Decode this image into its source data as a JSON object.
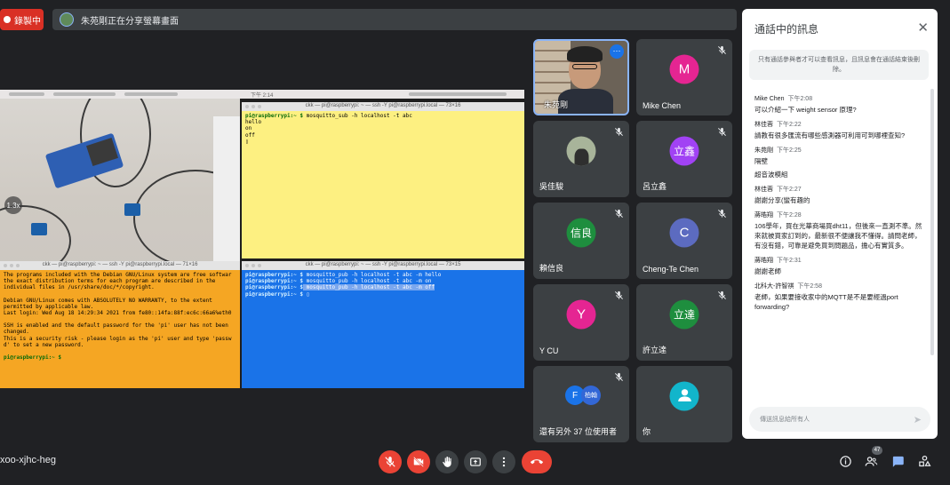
{
  "top": {
    "recording_label": "錄製中",
    "presenting_text": "朱苑剛正在分享螢幕畫面"
  },
  "screen": {
    "menubar_time": "下午 2:14",
    "photo_zoom": "1.3x",
    "term_yellow_title": "ckk — pi@raspberrypi: ~ — ssh -Y pi@raspberrypi.local — 73×16",
    "term_yellow_lines": [
      {
        "prompt": "pi@raspberrypi:~ $",
        "cmd": " mosquitto_sub -h localhost -t abc"
      },
      {
        "prompt": "",
        "cmd": "hello"
      },
      {
        "prompt": "",
        "cmd": "on"
      },
      {
        "prompt": "",
        "cmd": "off"
      },
      {
        "prompt": "",
        "cmd": "▯"
      }
    ],
    "term_orange_title": "ckk — pi@raspberrypi: ~ — ssh -Y pi@raspberrypi.local — 71×16",
    "term_orange_lines": [
      "The programs included with the Debian GNU/Linux system are free softwar",
      "the exact distribution terms for each program are described in the",
      "individual files in /usr/share/doc/*/copyright.",
      "",
      "Debian GNU/Linux comes with ABSOLUTELY NO WARRANTY, to the extent",
      "permitted by applicable law.",
      "Last login: Wed Aug 18 14:29:34 2021 from fe80::14fa:88f:ec6c:66a6%eth0",
      "",
      "SSH is enabled and the default password for the 'pi' user has not been",
      "changed.",
      "This is a security risk - please login as the 'pi' user and type 'passw",
      "d' to set a new password.",
      ""
    ],
    "term_orange_prompt": "pi@raspberrypi:~ $",
    "term_blue_title": "ckk — pi@raspberrypi: ~ — ssh -Y pi@raspberrypi.local — 73×15",
    "term_blue_lines": [
      {
        "prompt": "pi@raspberrypi:~ $",
        "cmd": " mosquitto_pub -h localhost -t abc -m hello",
        "selected": false
      },
      {
        "prompt": "pi@raspberrypi:~ $",
        "cmd": " mosquitto_pub -h localhost -t abc -m on",
        "selected": false
      },
      {
        "prompt": "pi@raspberrypi:~ $",
        "cmd": " mosquitto_pub -h localhost -t abc -m off",
        "selected": true
      },
      {
        "prompt": "pi@raspberrypi:~ $",
        "cmd": " ▯",
        "selected": false
      }
    ]
  },
  "participants": [
    {
      "name": "朱苑剛",
      "avatar_text": "",
      "avatar_color": "",
      "type": "video"
    },
    {
      "name": "Mike Chen",
      "avatar_text": "M",
      "avatar_color": "#e52592"
    },
    {
      "name": "吳佳駿",
      "avatar_text": "",
      "avatar_color": "",
      "type": "photo"
    },
    {
      "name": "呂立鑫",
      "avatar_text": "立鑫",
      "avatar_color": "#a142f4"
    },
    {
      "name": "賴信良",
      "avatar_text": "信良",
      "avatar_color": "#1e8e3e"
    },
    {
      "name": "Cheng-Te Chen",
      "avatar_text": "C",
      "avatar_color": "#5c6bc0"
    },
    {
      "name": "Y CU",
      "avatar_text": "Y",
      "avatar_color": "#e52592"
    },
    {
      "name": "許立達",
      "avatar_text": "立達",
      "avatar_color": "#1e8e3e"
    },
    {
      "name": "還有另外 37 位使用者",
      "avatar_text": "F",
      "avatar_text2": "柏翰",
      "avatar_color": "#1a73e8",
      "avatar_color2": "#3367d6"
    },
    {
      "name": "你",
      "avatar_text": "",
      "avatar_color": "#12b5cb",
      "type": "you"
    }
  ],
  "chat": {
    "title": "通話中的訊息",
    "notice": "只有通話參與者才可以查看訊息，且訊息會在通話結束後刪除。",
    "messages": [
      {
        "sender": "Mike Chen",
        "time": "下午2:08",
        "texts": [
          "可以介紹一下 weight sensor 原理?"
        ]
      },
      {
        "sender": "林佳蓉",
        "time": "下午2:22",
        "texts": [
          "請教有很多匯流有哪些感測器可利用可到哪裡查知?"
        ]
      },
      {
        "sender": "朱苑剛",
        "time": "下午2:25",
        "texts": [
          "隔壁",
          "超音波模組"
        ]
      },
      {
        "sender": "林佳蓉",
        "time": "下午2:27",
        "texts": [
          "謝謝分享(蠻有趣的"
        ]
      },
      {
        "sender": "蔣皓翔",
        "time": "下午2:28",
        "texts": [
          "106學年，買在光華商場買dht11，但後來一直測不準。然來就被買家訂到的，最新很不便讓我不懂得。請問老師，有沒有錯，可靠是避免買到問題品，擔心有實質多。"
        ]
      },
      {
        "sender": "蔣皓翔",
        "time": "下午2:31",
        "texts": [
          "謝謝老師"
        ]
      },
      {
        "sender": "北科大-許智祺",
        "time": "下午2:58",
        "texts": [
          "老師，如果要接收家中的MQTT是不是要經過port forwarding?"
        ]
      }
    ],
    "input_placeholder": "傳送訊息給所有人"
  },
  "bottom": {
    "meeting_code": "xoo-xjhc-heg",
    "participant_count": "47"
  },
  "colors": {
    "record_red": "#d93025",
    "hangup_red": "#ea4335",
    "accent_blue": "#8ab4f8",
    "bg_dark": "#202124",
    "tile_gray": "#3c4043"
  }
}
